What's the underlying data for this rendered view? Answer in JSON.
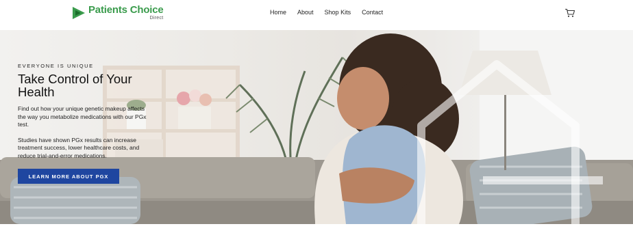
{
  "brand": {
    "name": "Patients Choice",
    "sub": "Direct",
    "color": "#3a9b4c"
  },
  "nav": {
    "items": [
      {
        "label": "Home"
      },
      {
        "label": "About"
      },
      {
        "label": "Shop Kits"
      },
      {
        "label": "Contact"
      }
    ],
    "cart_icon": "cart-icon"
  },
  "hero": {
    "eyebrow": "EVERYONE IS UNIQUE",
    "headline": "Take Control of Your Health",
    "paragraph1": "Find out how your unique genetic makeup affects the way you metabolize medications with our PGx test.",
    "paragraph2": "Studies have shown PGx results can increase treatment success, lower healthcare costs, and reduce trial-and-error medications.",
    "cta_label": "LEARN MORE ABOUT PGX",
    "cta_color": "#1f46a0"
  }
}
